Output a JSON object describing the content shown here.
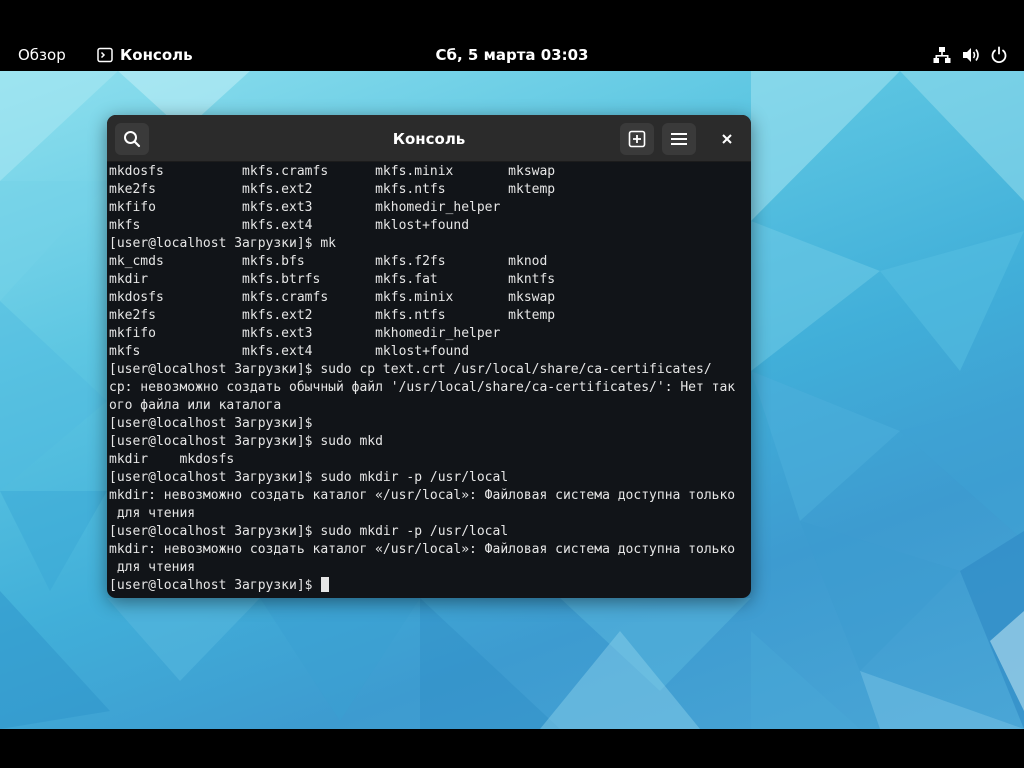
{
  "topbar": {
    "activities_label": "Обзор",
    "app_label": "Консоль",
    "clock": "Сб, 5 марта  03:03",
    "icons": {
      "app": "terminal-icon",
      "network": "network-wired-icon",
      "volume": "volume-icon",
      "power": "power-icon"
    }
  },
  "terminal": {
    "title": "Консоль",
    "buttons": {
      "search": "search-icon",
      "new_tab": "new-tab-icon",
      "menu": "hamburger-menu-icon",
      "close": "close-icon"
    },
    "lines": [
      "mkdosfs          mkfs.cramfs      mkfs.minix       mkswap",
      "mke2fs           mkfs.ext2        mkfs.ntfs        mktemp",
      "mkfifo           mkfs.ext3        mkhomedir_helper",
      "mkfs             mkfs.ext4        mklost+found",
      "[user@localhost Загрузки]$ mk",
      "mk_cmds          mkfs.bfs         mkfs.f2fs        mknod",
      "mkdir            mkfs.btrfs       mkfs.fat         mkntfs",
      "mkdosfs          mkfs.cramfs      mkfs.minix       mkswap",
      "mke2fs           mkfs.ext2        mkfs.ntfs        mktemp",
      "mkfifo           mkfs.ext3        mkhomedir_helper",
      "mkfs             mkfs.ext4        mklost+found",
      "[user@localhost Загрузки]$ sudo cp text.crt /usr/local/share/ca-certificates/",
      "cp: невозможно создать обычный файл '/usr/local/share/ca-certificates/': Нет так",
      "ого файла или каталога",
      "[user@localhost Загрузки]$",
      "[user@localhost Загрузки]$ sudo mkd",
      "mkdir    mkdosfs",
      "[user@localhost Загрузки]$ sudo mkdir -p /usr/local",
      "mkdir: невозможно создать каталог «/usr/local»: Файловая система доступна только",
      " для чтения",
      "[user@localhost Загрузки]$ sudo mkdir -p /usr/local",
      "mkdir: невозможно создать каталог «/usr/local»: Файловая система доступна только",
      " для чтения",
      "[user@localhost Загрузки]$ "
    ]
  },
  "colors": {
    "terminal_bg": "#111418",
    "terminal_fg": "#e6e6e6",
    "headerbar_bg": "#2b2b2b",
    "topbar_bg": "#000000"
  }
}
